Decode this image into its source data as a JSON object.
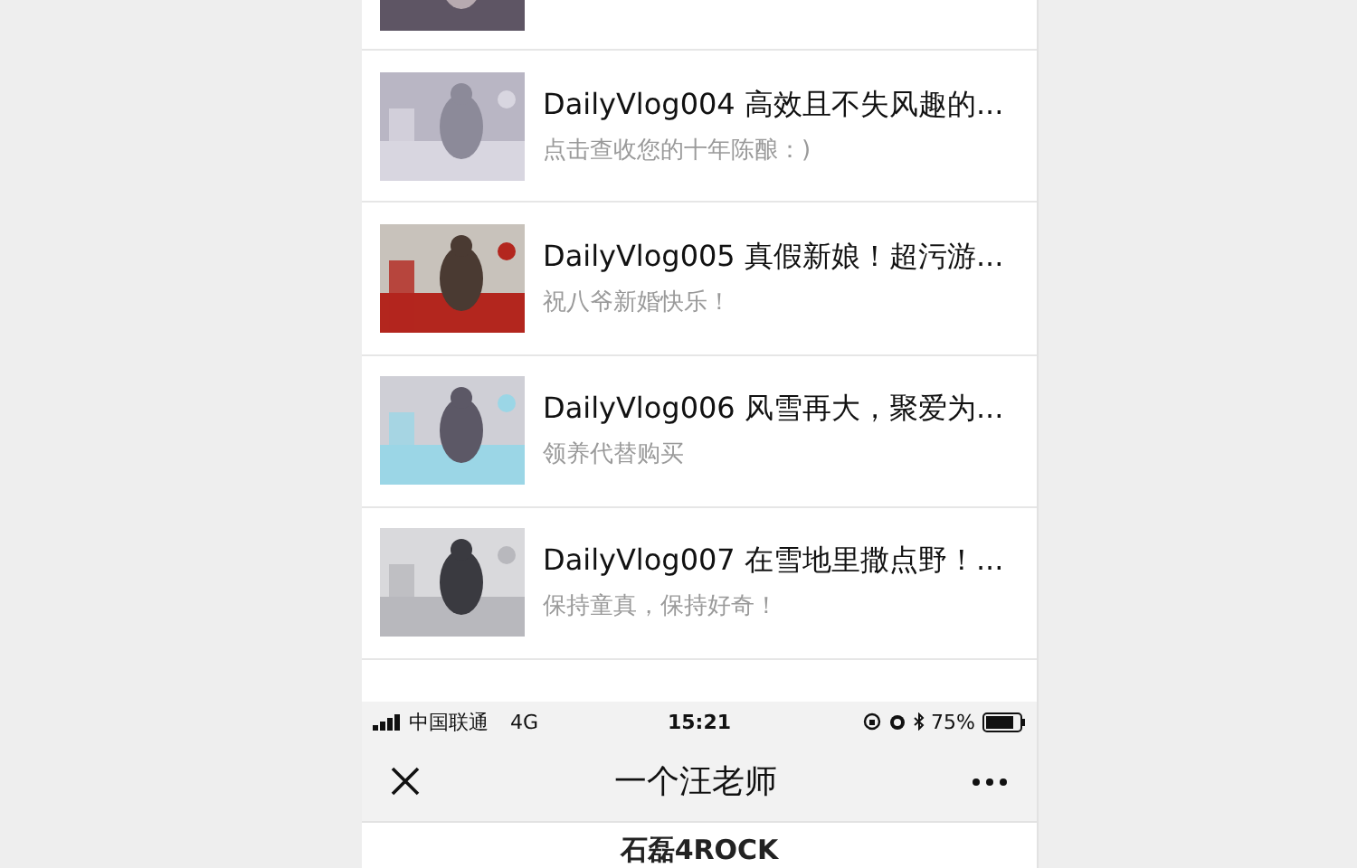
{
  "articles": [
    {
      "title": "DailyVlog004 高效且不失风趣的...",
      "subtitle": "点击查收您的十年陈酿：)"
    },
    {
      "title": "DailyVlog005 真假新娘！超污游...",
      "subtitle": "祝八爷新婚快乐！"
    },
    {
      "title": "DailyVlog006 风雪再大，聚爱为...",
      "subtitle": "领养代替购买"
    },
    {
      "title": "DailyVlog007 在雪地里撒点野！...",
      "subtitle": "保持童真，保持好奇！"
    }
  ],
  "status_bar": {
    "carrier": "中国联通",
    "network": "4G",
    "time": "15:21",
    "battery": "75%"
  },
  "nav_bar": {
    "title": "一个汪老师"
  },
  "page": {
    "heading": "石磊4ROCK"
  }
}
